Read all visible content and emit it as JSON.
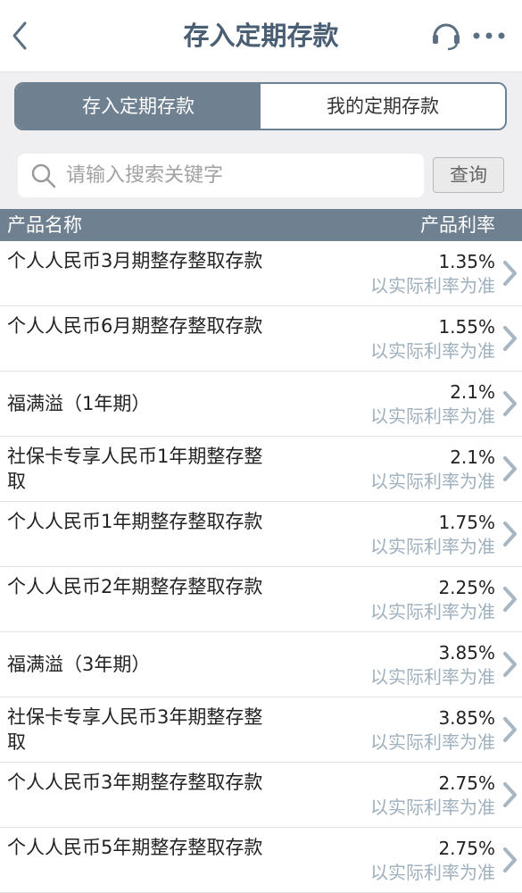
{
  "header": {
    "title": "存入定期存款"
  },
  "tabs": [
    {
      "label": "存入定期存款",
      "active": true
    },
    {
      "label": "我的定期存款",
      "active": false
    }
  ],
  "search": {
    "placeholder": "请输入搜索关键字",
    "button_label": "查询"
  },
  "table": {
    "col_name": "产品名称",
    "col_rate": "产品利率",
    "rows": [
      {
        "name": "个人人民币3月期整存整取存款",
        "rate": "1.35%",
        "note": "以实际利率为准"
      },
      {
        "name": "个人人民币6月期整存整取存款",
        "rate": "1.55%",
        "note": "以实际利率为准"
      },
      {
        "name": "福满溢（1年期）",
        "rate": "2.1%",
        "note": "以实际利率为准"
      },
      {
        "name": "社保卡专享人民币1年期整存整取",
        "rate": "2.1%",
        "note": "以实际利率为准"
      },
      {
        "name": "个人人民币1年期整存整取存款",
        "rate": "1.75%",
        "note": "以实际利率为准"
      },
      {
        "name": "个人人民币2年期整存整取存款",
        "rate": "2.25%",
        "note": "以实际利率为准"
      },
      {
        "name": "福满溢（3年期）",
        "rate": "3.85%",
        "note": "以实际利率为准"
      },
      {
        "name": "社保卡专享人民币3年期整存整取",
        "rate": "3.85%",
        "note": "以实际利率为准"
      },
      {
        "name": "个人人民币3年期整存整取存款",
        "rate": "2.75%",
        "note": "以实际利率为准"
      },
      {
        "name": "个人人民币5年期整存整取存款",
        "rate": "2.75%",
        "note": "以实际利率为准"
      }
    ]
  },
  "colors": {
    "accent": "#6f8191",
    "title": "#4a5f73",
    "note": "#9fb0bd"
  },
  "icons": [
    "back-arrow-icon",
    "customer-service-icon",
    "more-icon",
    "search-icon",
    "chevron-right-icon"
  ]
}
